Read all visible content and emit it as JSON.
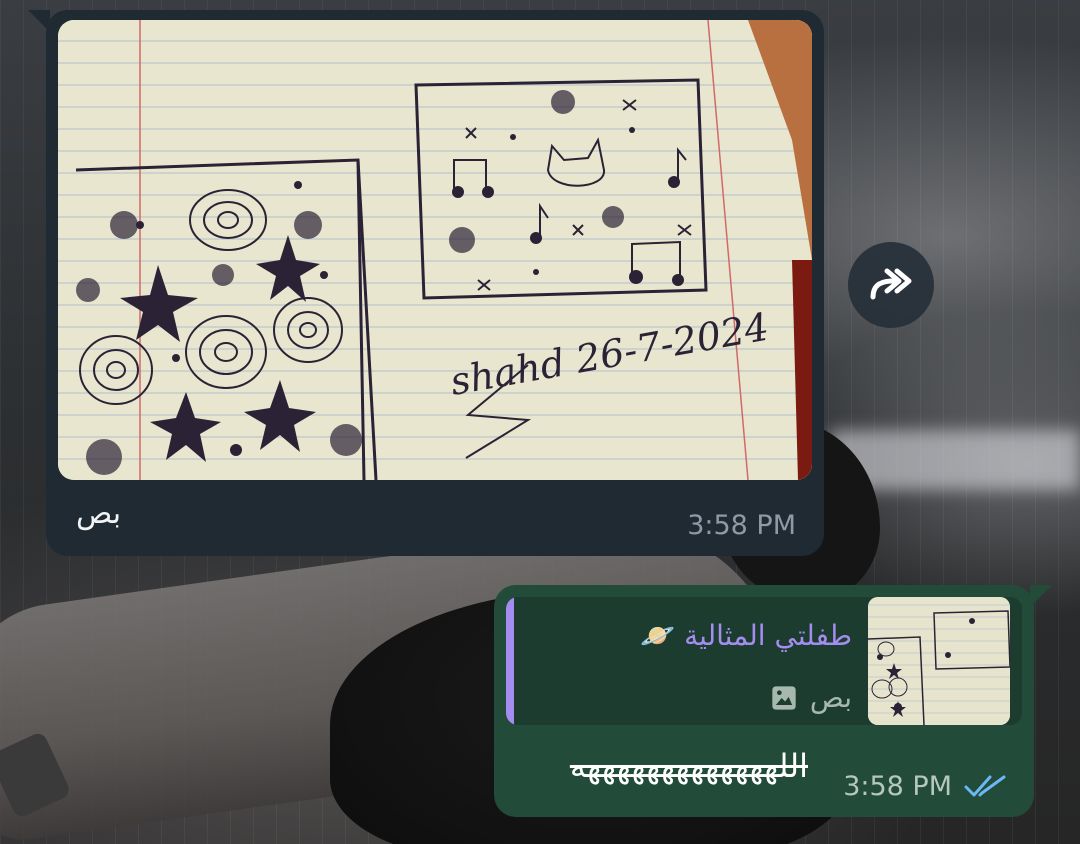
{
  "incoming": {
    "caption": "بص",
    "time": "3:58 PM",
    "photo_signature": "shahd 26-7-2024"
  },
  "outgoing": {
    "reply": {
      "author": "طفلتي المثالية",
      "author_emoji": "🪐",
      "snippet": "بص",
      "snippet_icon": "image-icon"
    },
    "text": "اللهههههههههههههه",
    "time": "3:58 PM",
    "status": "read",
    "status_icon": "double-check-icon"
  },
  "forward_icon": "forward-icon",
  "colors": {
    "incoming_bubble": "#1f2a33",
    "outgoing_bubble": "#224b3a",
    "reply_accent": "#a58cf0",
    "read_ticks": "#6cb8f4"
  }
}
